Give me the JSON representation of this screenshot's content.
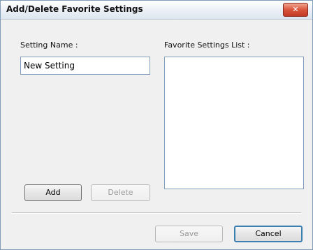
{
  "dialog": {
    "title": "Add/Delete Favorite Settings",
    "close_symbol": "✕"
  },
  "setting_name": {
    "label": "Setting Name :",
    "value": "New Setting"
  },
  "favorites_list": {
    "label": "Favorite Settings List :",
    "items": []
  },
  "buttons": {
    "add": "Add",
    "delete": "Delete",
    "save": "Save",
    "cancel": "Cancel"
  }
}
